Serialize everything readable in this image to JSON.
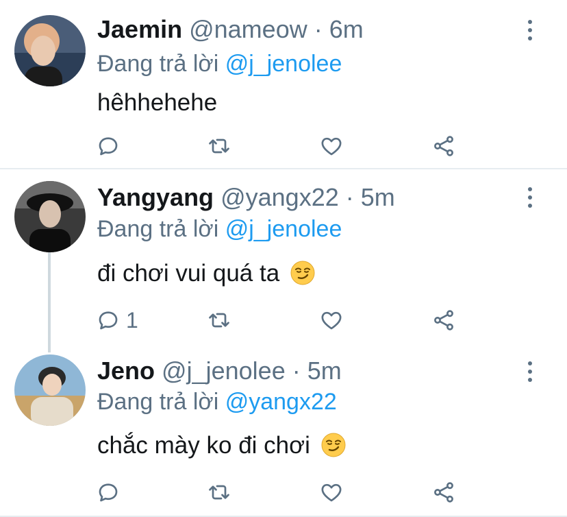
{
  "tweets": [
    {
      "name": "Jaemin",
      "handle": "@nameow",
      "dot": "·",
      "time": "6m",
      "reply_prefix": "Đang trả lời",
      "reply_to": "@j_jenolee",
      "text": "hêhhehehe",
      "emoji": "",
      "reply_count": "",
      "avatar_colors": {
        "bg": "#4a5d78",
        "skin": "#e9c9b0",
        "hair": "#e3b08a"
      }
    },
    {
      "name": "Yangyang",
      "handle": "@yangx22",
      "dot": "·",
      "time": "5m",
      "reply_prefix": "Đang trả lời",
      "reply_to": "@j_jenolee",
      "text": "đi chơi vui quá ta",
      "emoji": "smirking-face",
      "reply_count": "1",
      "avatar_colors": {
        "bg": "#3a3a3a",
        "skin": "#d8c2b0",
        "hair": "#111111"
      }
    },
    {
      "name": "Jeno",
      "handle": "@j_jenolee",
      "dot": "·",
      "time": "5m",
      "reply_prefix": "Đang trả lời",
      "reply_to": "@yangx22",
      "text": "chắc mày ko đi chơi",
      "emoji": "smirking-face",
      "reply_count": "",
      "avatar_colors": {
        "bg": "#8fb7d6",
        "skin": "#efd3bd",
        "hair": "#2a2a2a"
      }
    }
  ],
  "icons": {
    "reply": "reply-icon",
    "retweet": "retweet-icon",
    "like": "heart-icon",
    "share": "share-icon",
    "more": "more-vertical-icon"
  },
  "colors": {
    "accent": "#1d9bf0",
    "muted": "#5b7083",
    "divider": "#e6ecf0"
  }
}
